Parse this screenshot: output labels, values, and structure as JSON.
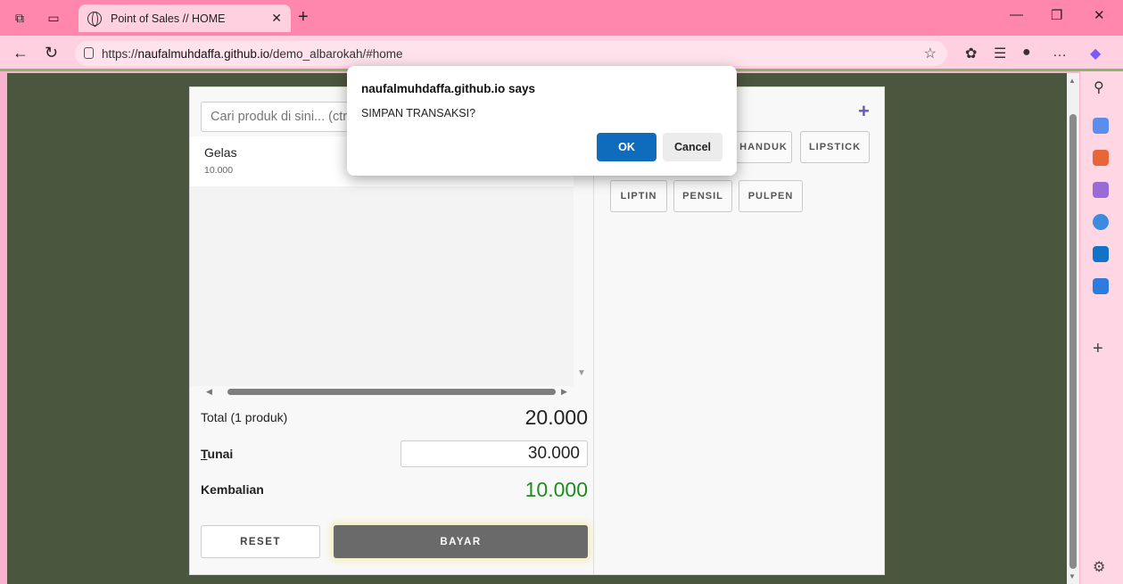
{
  "browser": {
    "tab_title": "Point of Sales // HOME",
    "url_prefix": "https://",
    "url_host": "naufalmuhdaffa.github.io",
    "url_path": "/demo_albarokah/#home"
  },
  "pos": {
    "search_placeholder": "Cari produk di sini... (ctrl+",
    "cart_items": [
      {
        "name": "Gelas",
        "price": "10.000"
      }
    ],
    "total_label": "Total (1 produk)",
    "total_value": "20.000",
    "cash_label_first": "T",
    "cash_label_rest": "unai",
    "cash_value": "30.000",
    "change_label": "Kembalian",
    "change_value": "10.000",
    "reset_label": "RESET",
    "pay_label": "BAYAR",
    "add_product_symbol": "+",
    "product_chips": [
      "HANDUK",
      "LIPSTICK",
      "LIPTIN",
      "PENSIL",
      "PULPEN"
    ]
  },
  "dialog": {
    "title": "naufalmuhdaffa.github.io says",
    "message": "SIMPAN TRANSAKSI?",
    "ok_label": "OK",
    "cancel_label": "Cancel"
  },
  "colors": {
    "tabbar": "#ff86ad",
    "viewport_bg": "#4b563f",
    "change_green": "#1f8c1f",
    "ok_blue": "#0f6cbd",
    "plus_purple": "#6b53c9"
  }
}
